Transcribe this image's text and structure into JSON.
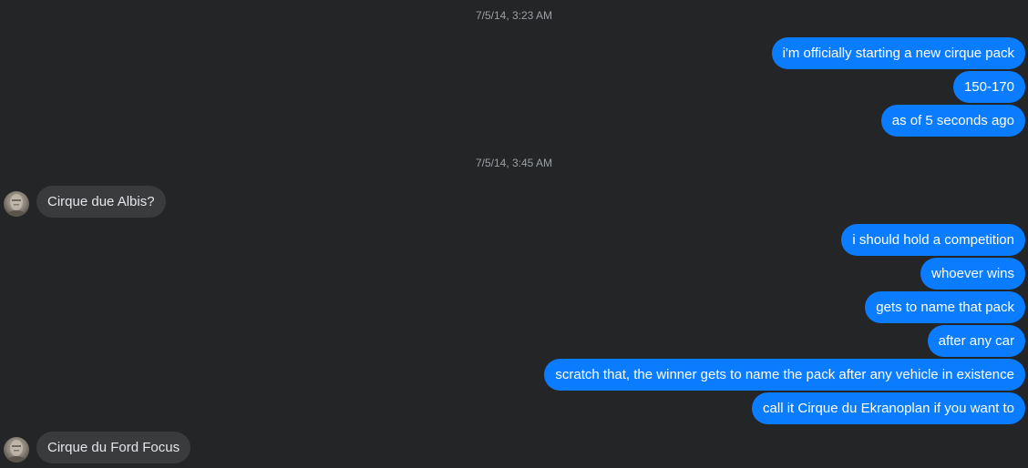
{
  "thread": {
    "groups": [
      {
        "timestamp": "7/5/14, 3:23 AM",
        "messages": [
          "i'm officially starting a new cirque pack",
          "150-170",
          "as of 5 seconds ago"
        ]
      },
      {
        "timestamp": "7/5/14, 3:45 AM",
        "messages": [
          "Cirque due Albis?",
          "i should hold a competition",
          "whoever wins",
          "gets to name that pack",
          "after any car",
          "scratch that, the winner gets to name the pack after any vehicle in existence",
          "call it Cirque du Ekranoplan if you want to",
          "Cirque du Ford Focus"
        ]
      }
    ]
  },
  "icons": {
    "avatar": "user-avatar-icon"
  },
  "colors": {
    "background": "#242526",
    "outgoing_bubble": "#0a7cff",
    "incoming_bubble": "#3a3b3c",
    "timestamp_text": "#9aa0a6"
  }
}
